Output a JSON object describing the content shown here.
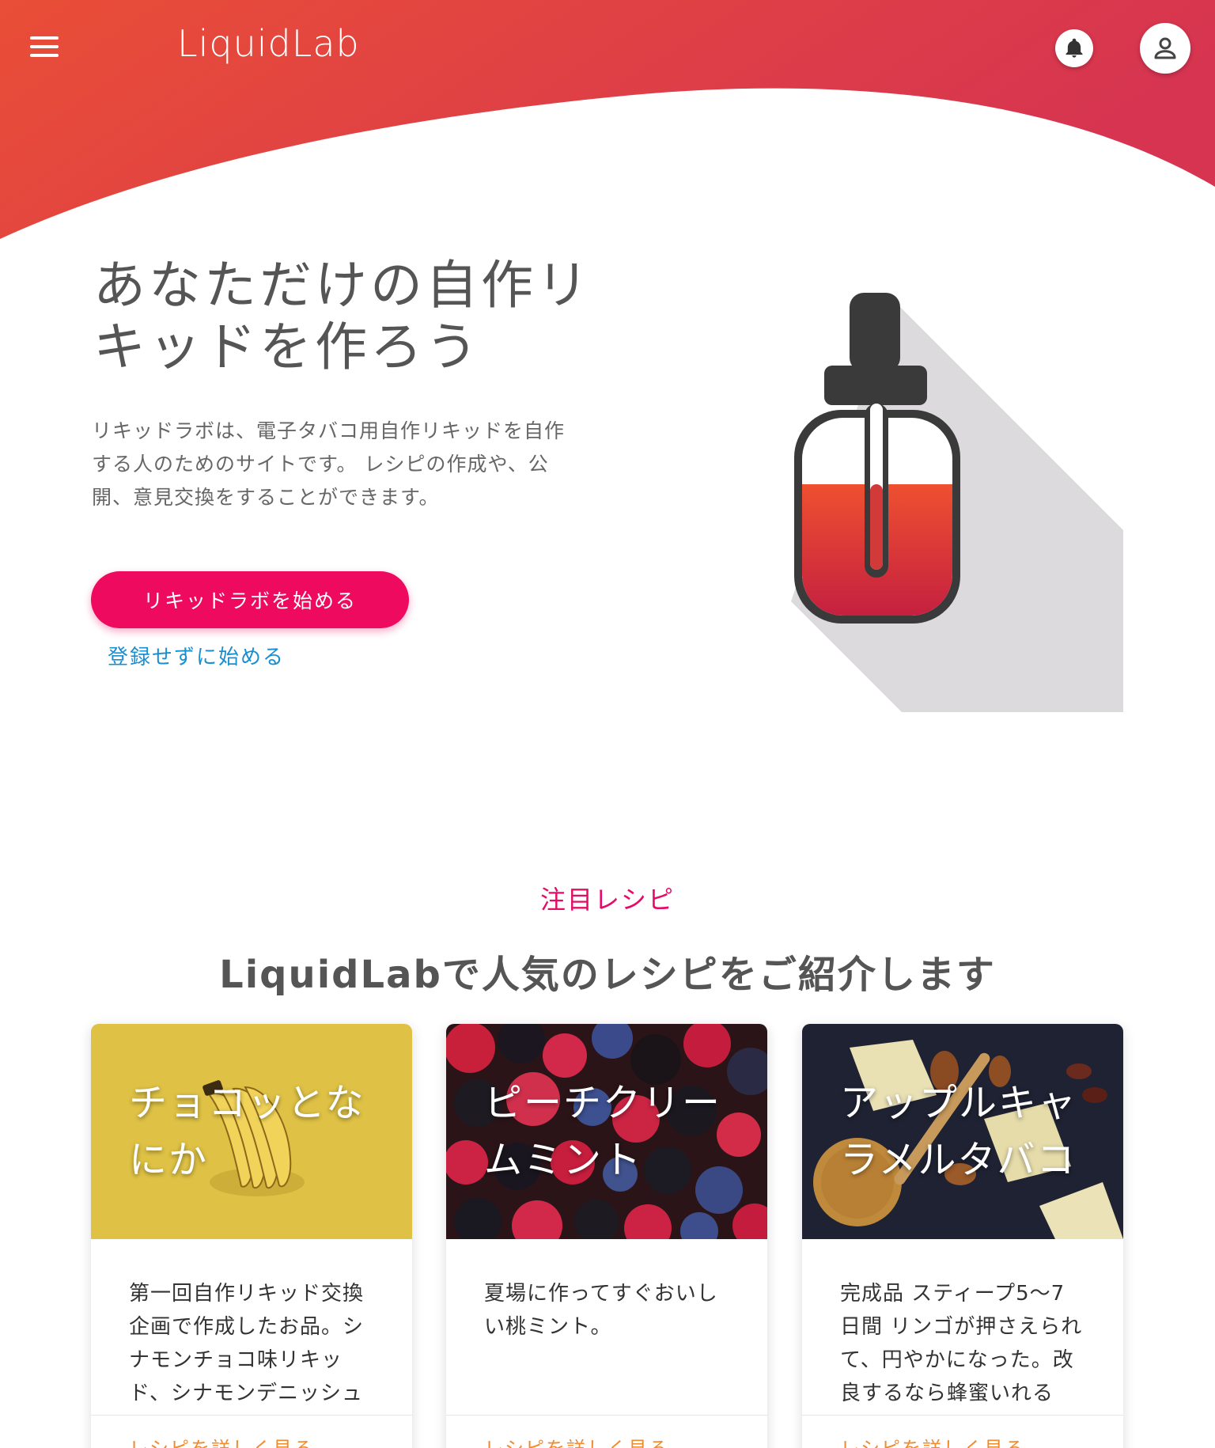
{
  "header": {
    "logo": "LiquidLab",
    "gradient_start": "#e94e37",
    "gradient_end": "#d63451",
    "icons": {
      "menu": "hamburger-menu-icon",
      "bell": "bell-icon",
      "account": "person-icon"
    }
  },
  "hero": {
    "title": "あなただけの自作リキッドを作ろう",
    "description": "リキッドラボは、電子タバコ用自作リキッドを自作する人のためのサイトです。 レシピの作成や、公開、意見交換をすることができます。",
    "cta_label": "リキッドラボを始める",
    "guest_link": "登録せずに始める",
    "accent_color": "#ee0a5e",
    "link_color": "#1a8fd0"
  },
  "featured": {
    "eyebrow": "注目レシピ",
    "title": "LiquidLabで人気のレシピをご紹介します",
    "cards": [
      {
        "title": "チョコッとなにか",
        "description": "第一回自作リキッド交換企画で作成したお品。シナモンチョコ味リキッド、シナモンデニッシュ",
        "link": "レシピを詳しく見る"
      },
      {
        "title": "ピーチクリームミント",
        "description": "夏場に作ってすぐおいしい桃ミント。",
        "link": "レシピを詳しく見る"
      },
      {
        "title": "アップルキャラメルタバコ",
        "description": "完成品 スティープ5〜7日間 リンゴが押さえられて、円やかになった。改良するなら蜂蜜いれる",
        "link": "レシピを詳しく見る"
      }
    ]
  }
}
